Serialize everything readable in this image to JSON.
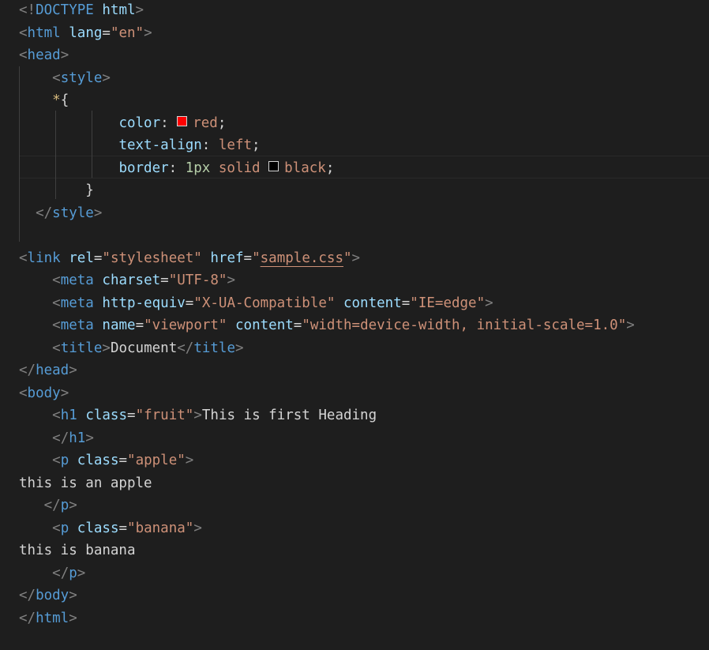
{
  "editor": {
    "lines": [
      {
        "tokens": [
          {
            "c": "t-punct",
            "t": "<!"
          },
          {
            "c": "t-tag",
            "t": "DOCTYPE"
          },
          {
            "c": "t-text",
            "t": " "
          },
          {
            "c": "t-attr",
            "t": "html"
          },
          {
            "c": "t-punct",
            "t": ">"
          }
        ]
      },
      {
        "tokens": [
          {
            "c": "t-punct",
            "t": "<"
          },
          {
            "c": "t-tag",
            "t": "html"
          },
          {
            "c": "t-text",
            "t": " "
          },
          {
            "c": "t-attr",
            "t": "lang"
          },
          {
            "c": "t-op",
            "t": "="
          },
          {
            "c": "t-str",
            "t": "\"en\""
          },
          {
            "c": "t-punct",
            "t": ">"
          }
        ]
      },
      {
        "tokens": [
          {
            "c": "t-punct",
            "t": "<"
          },
          {
            "c": "t-tag",
            "t": "head"
          },
          {
            "c": "t-punct",
            "t": ">"
          }
        ]
      },
      {
        "tokens": [
          {
            "c": "t-text",
            "t": "    "
          },
          {
            "c": "t-punct",
            "t": "<"
          },
          {
            "c": "t-tag",
            "t": "style"
          },
          {
            "c": "t-punct",
            "t": ">"
          }
        ]
      },
      {
        "tokens": [
          {
            "c": "t-text",
            "t": "    "
          },
          {
            "c": "t-sel",
            "t": "*"
          },
          {
            "c": "t-brace",
            "t": "{"
          }
        ]
      },
      {
        "tokens": [
          {
            "c": "t-text",
            "t": "            "
          },
          {
            "c": "t-prop",
            "t": "color"
          },
          {
            "c": "t-op",
            "t": ": "
          },
          {
            "c": "swatch",
            "color": "#ff0000"
          },
          {
            "c": "t-val",
            "t": "red"
          },
          {
            "c": "t-op",
            "t": ";"
          }
        ]
      },
      {
        "tokens": [
          {
            "c": "t-text",
            "t": "            "
          },
          {
            "c": "t-prop",
            "t": "text-align"
          },
          {
            "c": "t-op",
            "t": ": "
          },
          {
            "c": "t-val",
            "t": "left"
          },
          {
            "c": "t-op",
            "t": ";"
          }
        ]
      },
      {
        "tokens": [
          {
            "c": "t-text",
            "t": "            "
          },
          {
            "c": "t-prop",
            "t": "border"
          },
          {
            "c": "t-op",
            "t": ": "
          },
          {
            "c": "t-num",
            "t": "1px"
          },
          {
            "c": "t-text",
            "t": " "
          },
          {
            "c": "t-val",
            "t": "solid"
          },
          {
            "c": "t-text",
            "t": " "
          },
          {
            "c": "swatch",
            "color": "#000000"
          },
          {
            "c": "t-val",
            "t": "black"
          },
          {
            "c": "t-op",
            "t": ";"
          }
        ]
      },
      {
        "tokens": [
          {
            "c": "t-text",
            "t": "        "
          },
          {
            "c": "t-brace",
            "t": "}"
          }
        ]
      },
      {
        "tokens": [
          {
            "c": "t-text",
            "t": "  "
          },
          {
            "c": "t-punct",
            "t": "</"
          },
          {
            "c": "t-tag",
            "t": "style"
          },
          {
            "c": "t-punct",
            "t": ">"
          }
        ]
      },
      {
        "tokens": []
      },
      {
        "tokens": [
          {
            "c": "t-punct",
            "t": "<"
          },
          {
            "c": "t-tag",
            "t": "link"
          },
          {
            "c": "t-text",
            "t": " "
          },
          {
            "c": "t-attr",
            "t": "rel"
          },
          {
            "c": "t-op",
            "t": "="
          },
          {
            "c": "t-str",
            "t": "\"stylesheet\""
          },
          {
            "c": "t-text",
            "t": " "
          },
          {
            "c": "t-attr",
            "t": "href"
          },
          {
            "c": "t-op",
            "t": "="
          },
          {
            "c": "t-str",
            "t": "\""
          },
          {
            "c": "t-str t-link",
            "t": "sample.css"
          },
          {
            "c": "t-str",
            "t": "\""
          },
          {
            "c": "t-punct",
            "t": ">"
          }
        ]
      },
      {
        "tokens": [
          {
            "c": "t-text",
            "t": "    "
          },
          {
            "c": "t-punct",
            "t": "<"
          },
          {
            "c": "t-tag",
            "t": "meta"
          },
          {
            "c": "t-text",
            "t": " "
          },
          {
            "c": "t-attr",
            "t": "charset"
          },
          {
            "c": "t-op",
            "t": "="
          },
          {
            "c": "t-str",
            "t": "\"UTF-8\""
          },
          {
            "c": "t-punct",
            "t": ">"
          }
        ]
      },
      {
        "tokens": [
          {
            "c": "t-text",
            "t": "    "
          },
          {
            "c": "t-punct",
            "t": "<"
          },
          {
            "c": "t-tag",
            "t": "meta"
          },
          {
            "c": "t-text",
            "t": " "
          },
          {
            "c": "t-attr",
            "t": "http-equiv"
          },
          {
            "c": "t-op",
            "t": "="
          },
          {
            "c": "t-str",
            "t": "\"X-UA-Compatible\""
          },
          {
            "c": "t-text",
            "t": " "
          },
          {
            "c": "t-attr",
            "t": "content"
          },
          {
            "c": "t-op",
            "t": "="
          },
          {
            "c": "t-str",
            "t": "\"IE=edge\""
          },
          {
            "c": "t-punct",
            "t": ">"
          }
        ]
      },
      {
        "tokens": [
          {
            "c": "t-text",
            "t": "    "
          },
          {
            "c": "t-punct",
            "t": "<"
          },
          {
            "c": "t-tag",
            "t": "meta"
          },
          {
            "c": "t-text",
            "t": " "
          },
          {
            "c": "t-attr",
            "t": "name"
          },
          {
            "c": "t-op",
            "t": "="
          },
          {
            "c": "t-str",
            "t": "\"viewport\""
          },
          {
            "c": "t-text",
            "t": " "
          },
          {
            "c": "t-attr",
            "t": "content"
          },
          {
            "c": "t-op",
            "t": "="
          },
          {
            "c": "t-str",
            "t": "\"width=device-width, initial-scale=1.0\""
          },
          {
            "c": "t-punct",
            "t": ">"
          }
        ]
      },
      {
        "tokens": [
          {
            "c": "t-text",
            "t": "    "
          },
          {
            "c": "t-punct",
            "t": "<"
          },
          {
            "c": "t-tag",
            "t": "title"
          },
          {
            "c": "t-punct",
            "t": ">"
          },
          {
            "c": "t-text",
            "t": "Document"
          },
          {
            "c": "t-punct",
            "t": "</"
          },
          {
            "c": "t-tag",
            "t": "title"
          },
          {
            "c": "t-punct",
            "t": ">"
          }
        ]
      },
      {
        "tokens": [
          {
            "c": "t-punct",
            "t": "</"
          },
          {
            "c": "t-tag",
            "t": "head"
          },
          {
            "c": "t-punct",
            "t": ">"
          }
        ]
      },
      {
        "tokens": [
          {
            "c": "t-punct",
            "t": "<"
          },
          {
            "c": "t-tag",
            "t": "body"
          },
          {
            "c": "t-punct",
            "t": ">"
          }
        ]
      },
      {
        "tokens": [
          {
            "c": "t-text",
            "t": "    "
          },
          {
            "c": "t-punct",
            "t": "<"
          },
          {
            "c": "t-tag",
            "t": "h1"
          },
          {
            "c": "t-text",
            "t": " "
          },
          {
            "c": "t-attr",
            "t": "class"
          },
          {
            "c": "t-op",
            "t": "="
          },
          {
            "c": "t-str",
            "t": "\"fruit\""
          },
          {
            "c": "t-punct",
            "t": ">"
          },
          {
            "c": "t-text",
            "t": "This is first Heading"
          }
        ]
      },
      {
        "tokens": [
          {
            "c": "t-text",
            "t": "    "
          },
          {
            "c": "t-punct",
            "t": "</"
          },
          {
            "c": "t-tag",
            "t": "h1"
          },
          {
            "c": "t-punct",
            "t": ">"
          }
        ]
      },
      {
        "tokens": [
          {
            "c": "t-text",
            "t": "    "
          },
          {
            "c": "t-punct",
            "t": "<"
          },
          {
            "c": "t-tag",
            "t": "p"
          },
          {
            "c": "t-text",
            "t": " "
          },
          {
            "c": "t-attr",
            "t": "class"
          },
          {
            "c": "t-op",
            "t": "="
          },
          {
            "c": "t-str",
            "t": "\"apple\""
          },
          {
            "c": "t-punct",
            "t": ">"
          }
        ]
      },
      {
        "tokens": [
          {
            "c": "t-text",
            "t": "this is an apple"
          }
        ]
      },
      {
        "tokens": [
          {
            "c": "t-text",
            "t": "   "
          },
          {
            "c": "t-punct",
            "t": "</"
          },
          {
            "c": "t-tag",
            "t": "p"
          },
          {
            "c": "t-punct",
            "t": ">"
          }
        ]
      },
      {
        "tokens": [
          {
            "c": "t-text",
            "t": "    "
          },
          {
            "c": "t-punct",
            "t": "<"
          },
          {
            "c": "t-tag",
            "t": "p"
          },
          {
            "c": "t-text",
            "t": " "
          },
          {
            "c": "t-attr",
            "t": "class"
          },
          {
            "c": "t-op",
            "t": "="
          },
          {
            "c": "t-str",
            "t": "\"banana\""
          },
          {
            "c": "t-punct",
            "t": ">"
          }
        ]
      },
      {
        "tokens": [
          {
            "c": "t-text",
            "t": "this is banana"
          }
        ]
      },
      {
        "tokens": [
          {
            "c": "t-text",
            "t": "    "
          },
          {
            "c": "t-punct",
            "t": "</"
          },
          {
            "c": "t-tag",
            "t": "p"
          },
          {
            "c": "t-punct",
            "t": ">"
          }
        ]
      },
      {
        "tokens": [
          {
            "c": "t-punct",
            "t": "</"
          },
          {
            "c": "t-tag",
            "t": "body"
          },
          {
            "c": "t-punct",
            "t": ">"
          }
        ]
      },
      {
        "tokens": [
          {
            "c": "t-punct",
            "t": "</"
          },
          {
            "c": "t-tag",
            "t": "html"
          },
          {
            "c": "t-punct",
            "t": ">"
          }
        ]
      }
    ]
  }
}
